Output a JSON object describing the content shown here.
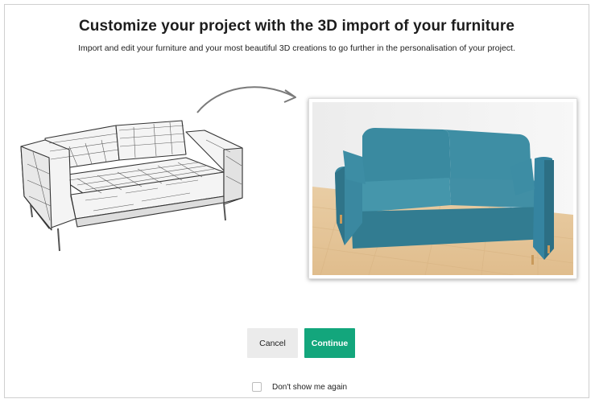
{
  "dialog": {
    "title": "Customize your project with the 3D import of your furniture",
    "subtitle": "Import and edit your furniture and your most beautiful 3D creations to go further in the personalisation of your project.",
    "illustration": {
      "left_icon": "wireframe-sofa-icon",
      "arrow_icon": "curved-arrow-icon",
      "right_icon": "rendered-sofa-image",
      "sofa_color": "#3e8ea4",
      "floor_color": "#e3c49a"
    },
    "buttons": {
      "cancel_label": "Cancel",
      "continue_label": "Continue"
    },
    "dont_show_label": "Don't show me again",
    "dont_show_checked": false,
    "colors": {
      "primary": "#13a67c",
      "secondary": "#ebebeb"
    }
  }
}
